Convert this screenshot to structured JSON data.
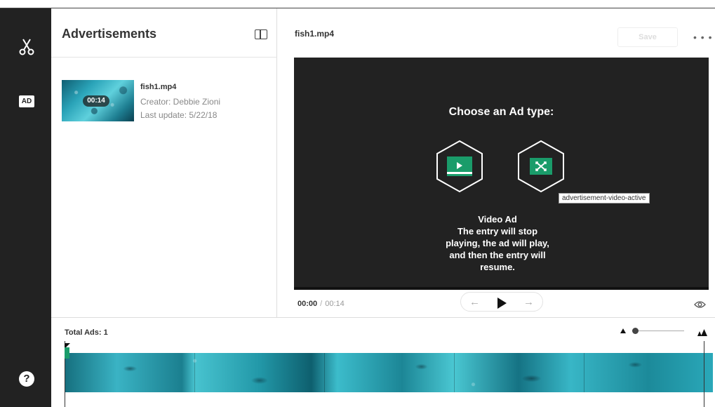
{
  "sidebar": {
    "items": [
      {
        "icon": "scissors-icon"
      },
      {
        "label": "AD",
        "icon": "ad-icon"
      },
      {
        "label": "?",
        "icon": "help-icon"
      }
    ]
  },
  "left_panel": {
    "title": "Advertisements",
    "entry": {
      "name": "fish1.mp4",
      "duration": "00:14",
      "creator": "Creator: Debbie Zioni",
      "last_update": "Last update: 5/22/18"
    }
  },
  "header": {
    "filename": "fish1.mp4",
    "save_label": "Save",
    "more_label": "• • •"
  },
  "player": {
    "prompt": "Choose an Ad type:",
    "ad_types": [
      {
        "name": "video-ad",
        "icon": "video-ad-icon"
      },
      {
        "name": "overlay-ad",
        "icon": "expand-icon"
      }
    ],
    "tooltip": "advertisement-video-active",
    "description_title": "Video Ad",
    "description_lines": [
      "The entry will stop",
      "playing, the ad will play,",
      "and then the entry will",
      "resume."
    ],
    "current_time": "00:00",
    "separator": "/",
    "total_time": "00:14"
  },
  "timeline": {
    "total_ads": "Total Ads: 1",
    "zoom_level": 0
  },
  "colors": {
    "rail": "#222222",
    "player_bg": "#222222",
    "accent_green": "#1a9c6a"
  }
}
